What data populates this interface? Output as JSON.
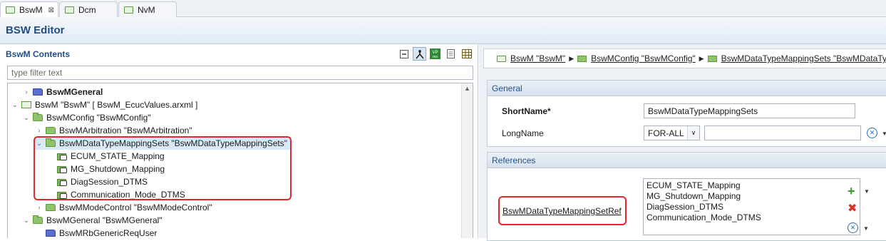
{
  "tabs": [
    {
      "label": "BswM",
      "close": "⊠"
    },
    {
      "label": "Dcm"
    },
    {
      "label": "NvM"
    }
  ],
  "editor": {
    "title": "BSW Editor"
  },
  "contents": {
    "title": "BswM Contents",
    "filter_placeholder": "type filter text",
    "toolbar": {
      "vp_label": "VP\nres"
    },
    "tree": [
      {
        "label": "BswMGeneral"
      },
      {
        "label": "BswM \"BswM\" [ BswM_EcucValues.arxml ]"
      },
      {
        "label": "BswMConfig \"BswMConfig\""
      },
      {
        "label": "BswMArbitration \"BswMArbitration\""
      },
      {
        "label": "BswMDataTypeMappingSets \"BswMDataTypeMappingSets\""
      },
      {
        "label": "ECUM_STATE_Mapping"
      },
      {
        "label": "MG_Shutdown_Mapping"
      },
      {
        "label": "DiagSession_DTMS"
      },
      {
        "label": "Communication_Mode_DTMS"
      },
      {
        "label": "BswMModeControl \"BswMModeControl\""
      },
      {
        "label": "BswMGeneral \"BswMGeneral\""
      },
      {
        "label": "BswMRbGenericReqUser"
      }
    ]
  },
  "breadcrumb": [
    {
      "label": "BswM \"BswM\""
    },
    {
      "label": "BswMConfig \"BswMConfig\""
    },
    {
      "label": "BswMDataTypeMappingSets \"BswMDataTy"
    }
  ],
  "general": {
    "header": "General",
    "shortname_label": "ShortName*",
    "shortname_value": "BswMDataTypeMappingSets",
    "longname_label": "LongName",
    "language": "FOR-ALL",
    "longname_value": ""
  },
  "references": {
    "header": "References",
    "ref_label": "BswMDataTypeMappingSetRef",
    "items": [
      "ECUM_STATE_Mapping",
      "MG_Shutdown_Mapping",
      "DiagSession_DTMS",
      "Communication_Mode_DTMS"
    ]
  },
  "colors": {
    "accent": "#1f4e87",
    "highlight": "#e2282d",
    "selection": "#dbe8f7"
  }
}
